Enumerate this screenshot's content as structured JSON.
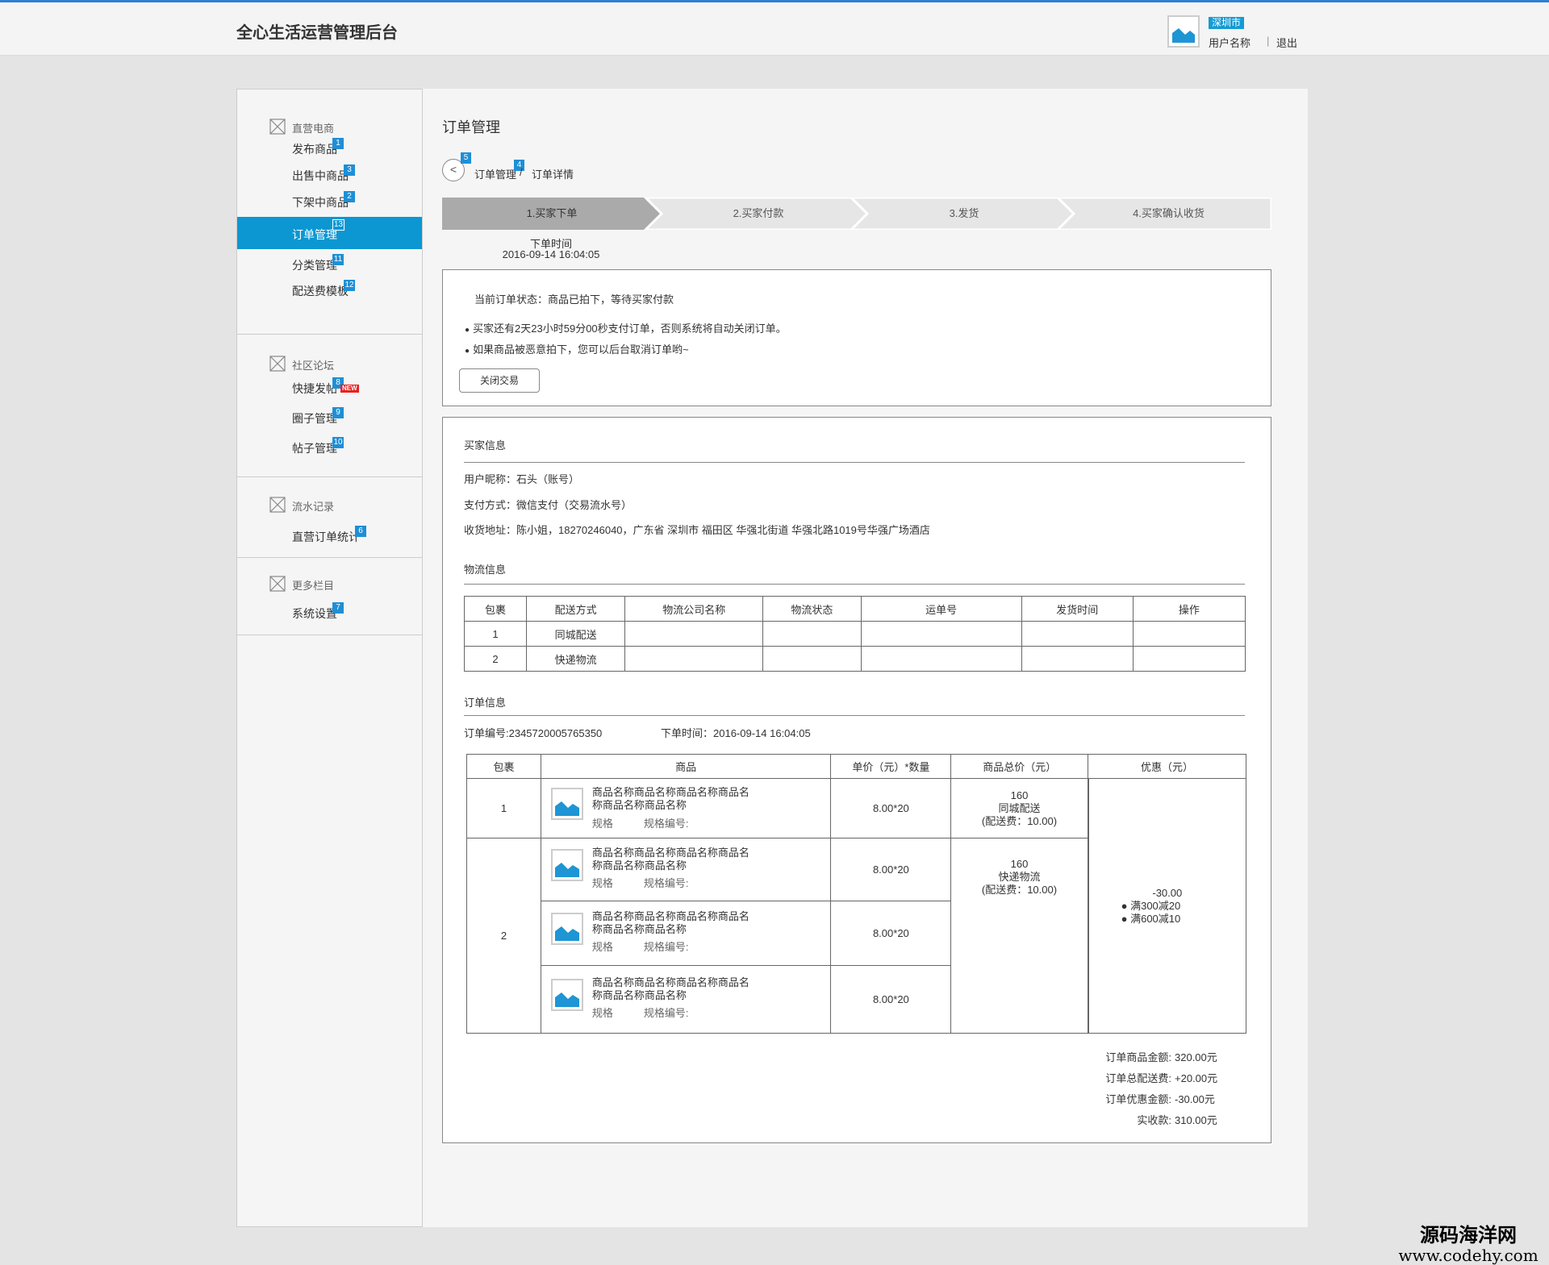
{
  "header": {
    "title": "全心生活运营管理后台",
    "city": "深圳市",
    "user_name": "用户名称",
    "separator": "|",
    "logout": "退出"
  },
  "sidebar": {
    "groups": [
      {
        "label": "直营电商",
        "items": [
          {
            "label": "发布商品",
            "badge": "1"
          },
          {
            "label": "出售中商品",
            "badge": "3"
          },
          {
            "label": "下架中商品",
            "badge": "2"
          },
          {
            "label": "订单管理",
            "badge": "13",
            "active": true
          },
          {
            "label": "分类管理",
            "badge": "11"
          },
          {
            "label": "配送费模板",
            "badge": "12"
          }
        ]
      },
      {
        "label": "社区论坛",
        "items": [
          {
            "label": "快捷发帖",
            "badge": "8",
            "tag": "NEW"
          },
          {
            "label": "圈子管理",
            "badge": "9"
          },
          {
            "label": "帖子管理",
            "badge": "10"
          }
        ]
      },
      {
        "label": "流水记录",
        "items": [
          {
            "label": "直营订单统计",
            "badge": "6"
          }
        ]
      },
      {
        "label": "更多栏目",
        "items": [
          {
            "label": "系统设置",
            "badge": "7"
          }
        ]
      }
    ]
  },
  "content": {
    "title": "订单管理",
    "back_icon": "<",
    "back_mark": "5",
    "breadcrumb": {
      "first": "订单管理",
      "sep": "/",
      "second": "订单详情",
      "mark": "4"
    },
    "steps": [
      "1.买家下单",
      "2.买家付款",
      "3.发货",
      "4.买家确认收货"
    ],
    "active_step_color": "#aaaaaa",
    "order_time_label": "下单时间",
    "order_time_value": "2016-09-14 16:04:05",
    "status": {
      "text": "当前订单状态：商品已拍下，等待买家付款",
      "tips": [
        "买家还有2天23小时59分00秒支付订单，否则系统将自动关闭订单。",
        "如果商品被恶意拍下，您可以后台取消订单哟~"
      ],
      "close_button": "关闭交易"
    },
    "buyer": {
      "title": "买家信息",
      "nickname": "用户昵称：石头（账号）",
      "payment": "支付方式：微信支付（交易流水号）",
      "address": "收货地址：陈小姐，18270246040，广东省 深圳市 福田区 华强北街道 华强北路1019号华强广场酒店"
    },
    "logistics": {
      "title": "物流信息",
      "headers": [
        "包裹",
        "配送方式",
        "物流公司名称",
        "物流状态",
        "运单号",
        "发货时间",
        "操作"
      ],
      "rows": [
        [
          "1",
          "同城配送",
          "",
          "",
          "",
          "",
          ""
        ],
        [
          "2",
          "快递物流",
          "",
          "",
          "",
          "",
          ""
        ]
      ]
    },
    "order": {
      "title": "订单信息",
      "number": "订单编号:2345720005765350",
      "time": "下单时间：2016-09-14 16:04:05",
      "headers": [
        "包裹",
        "商品",
        "单价（元）*数量",
        "商品总价（元）",
        "优惠（元）"
      ],
      "product_name": "商品名称商品名称商品名称商品名称商品名称商品名称",
      "spec": "规格",
      "spec_no": "规格编号:",
      "price_qty": "8.00*20",
      "packages": [
        {
          "id": "1",
          "total": "160",
          "method": "同城配送",
          "fee": "(配送费：10.00)"
        },
        {
          "id": "2",
          "total": "160",
          "method": "快递物流",
          "fee": "(配送费：10.00)"
        }
      ],
      "discount": {
        "amount": "-30.00",
        "rules": [
          "满300减20",
          "满600减10"
        ]
      },
      "summary": [
        {
          "label": "订单商品金额:",
          "value": "320.00元"
        },
        {
          "label": "订单总配送费:",
          "value": "+20.00元"
        },
        {
          "label": "订单优惠金额:",
          "value": "-30.00元"
        },
        {
          "label": "实收款:",
          "value": "310.00元"
        }
      ]
    }
  },
  "watermark": {
    "line1": "源码海洋网",
    "line2": "www.codehy.com"
  }
}
